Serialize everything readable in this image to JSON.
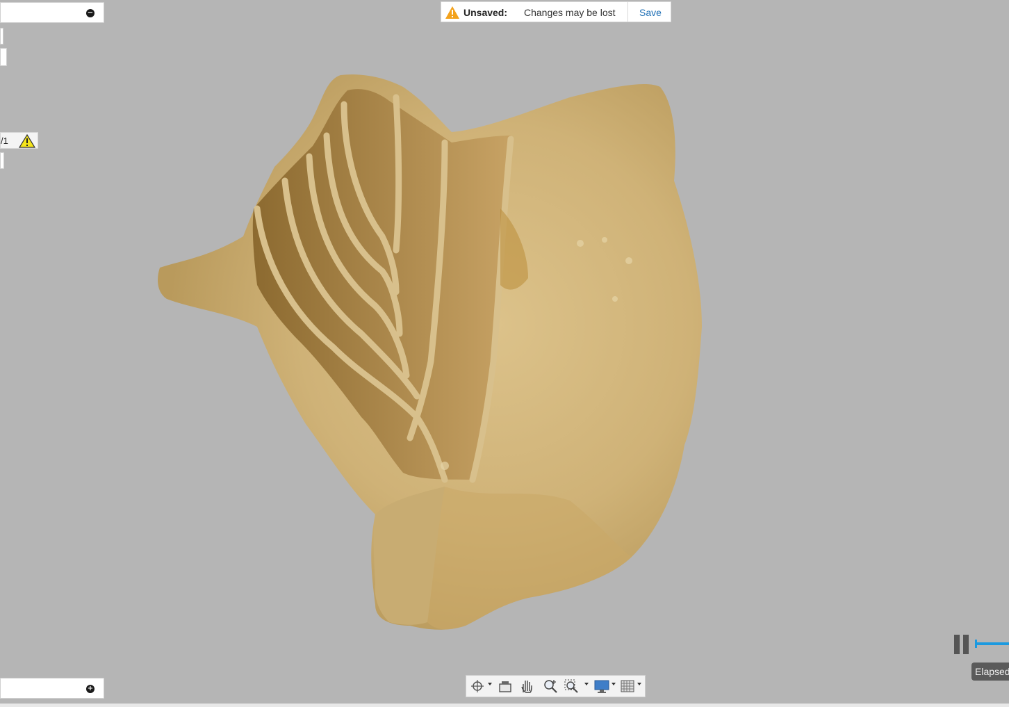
{
  "banner": {
    "title": "Unsaved:",
    "message": "Changes may be lost",
    "save_label": "Save",
    "warning_color": "#f3a21c"
  },
  "browser": {
    "collapse_icon": "minus-circle-icon",
    "expand_icon": "plus-circle-icon",
    "warning_row_text": "/1",
    "warning_icon": "warning-triangle-icon"
  },
  "navigation_bar": {
    "tools": [
      "orbit-icon",
      "look-at-icon",
      "pan-icon",
      "zoom-icon",
      "zoom-window-icon",
      "display-settings-icon",
      "grid-settings-icon"
    ]
  },
  "timeline": {
    "pause_icon": "pause-icon",
    "elapsed_label": "Elapsed",
    "accent_color": "#1c9ae0"
  },
  "viewport": {
    "background_color": "#b5b5b5",
    "model_color": "#d4b77e"
  }
}
